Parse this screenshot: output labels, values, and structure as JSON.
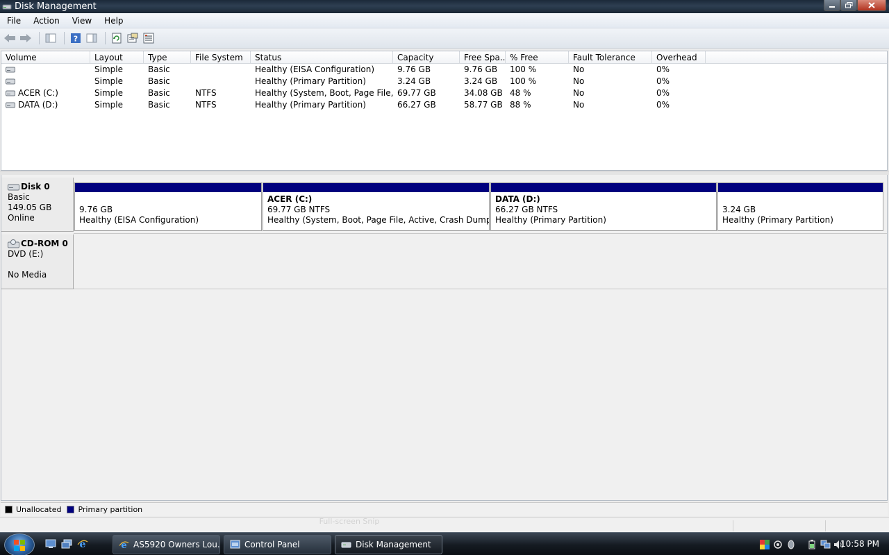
{
  "window": {
    "title": "Disk Management"
  },
  "menu": [
    "File",
    "Action",
    "View",
    "Help"
  ],
  "volumes": {
    "columns": [
      "Volume",
      "Layout",
      "Type",
      "File System",
      "Status",
      "Capacity",
      "Free Spa...",
      "% Free",
      "Fault Tolerance",
      "Overhead"
    ],
    "rows": [
      [
        "",
        "Simple",
        "Basic",
        "",
        "Healthy (EISA Configuration)",
        "9.76 GB",
        "9.76 GB",
        "100 %",
        "No",
        "0%"
      ],
      [
        "",
        "Simple",
        "Basic",
        "",
        "Healthy (Primary Partition)",
        "3.24 GB",
        "3.24 GB",
        "100 %",
        "No",
        "0%"
      ],
      [
        "ACER (C:)",
        "Simple",
        "Basic",
        "NTFS",
        "Healthy (System, Boot, Page File, A...",
        "69.77 GB",
        "34.08 GB",
        "48 %",
        "No",
        "0%"
      ],
      [
        "DATA (D:)",
        "Simple",
        "Basic",
        "NTFS",
        "Healthy (Primary Partition)",
        "66.27 GB",
        "58.77 GB",
        "88 %",
        "No",
        "0%"
      ]
    ]
  },
  "disks": [
    {
      "name": "Disk 0",
      "type": "Basic",
      "size": "149.05 GB",
      "state": "Online",
      "partitions": [
        {
          "name": "",
          "size": "9.76 GB",
          "status": "Healthy (EISA Configuration)"
        },
        {
          "name": "ACER  (C:)",
          "size": "69.77 GB NTFS",
          "status": "Healthy (System, Boot, Page File, Active, Crash Dump, Prim"
        },
        {
          "name": "DATA  (D:)",
          "size": "66.27 GB NTFS",
          "status": "Healthy (Primary Partition)"
        },
        {
          "name": "",
          "size": "3.24 GB",
          "status": "Healthy (Primary Partition)"
        }
      ]
    },
    {
      "name": "CD-ROM 0",
      "type": "DVD (E:)",
      "state": "No Media"
    }
  ],
  "legend": [
    {
      "label": "Unallocated",
      "color": "#000000"
    },
    {
      "label": "Primary partition",
      "color": "#00007e"
    }
  ],
  "statusbar": {
    "ghost_text": "Full-screen Snip"
  },
  "taskbar": {
    "tasks": [
      {
        "label": "AS5920 Owners Lou...",
        "icon": "internet-explorer-icon"
      },
      {
        "label": "Control Panel",
        "icon": "control-panel-icon"
      },
      {
        "label": "Disk Management",
        "icon": "disk-management-icon"
      }
    ],
    "clock": "10:58 PM"
  }
}
